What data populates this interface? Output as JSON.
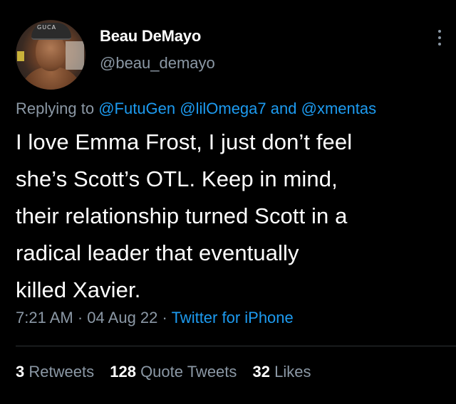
{
  "author": {
    "name": "Beau DeMayo",
    "handle": "@beau_demayo",
    "avatar_cap_text": "GUCA"
  },
  "reply": {
    "prefix": "Replying to",
    "mention_1": "@FutuGen",
    "mention_2": "@lilOmega7",
    "conjunction": "and",
    "mention_3": "@xmentas"
  },
  "tweet": {
    "lines": [
      "I love Emma Frost, I just don’t feel",
      "she’s Scott’s OTL. Keep in mind,",
      "their relationship turned Scott in a",
      "radical leader that eventually",
      "killed Xavier."
    ]
  },
  "meta": {
    "time": "7:21 AM",
    "separator": "·",
    "date": "04 Aug 22",
    "source": "Twitter for iPhone"
  },
  "stats": {
    "retweets_count": "3",
    "retweets_label": "Retweets",
    "quotes_count": "128",
    "quotes_label": "Quote Tweets",
    "likes_count": "32",
    "likes_label": "Likes"
  },
  "colors": {
    "background": "#000000",
    "text": "#ffffff",
    "secondary": "#8b98a5",
    "link": "#1d9bf0"
  },
  "icons": {
    "more": "more-vertical-icon"
  }
}
